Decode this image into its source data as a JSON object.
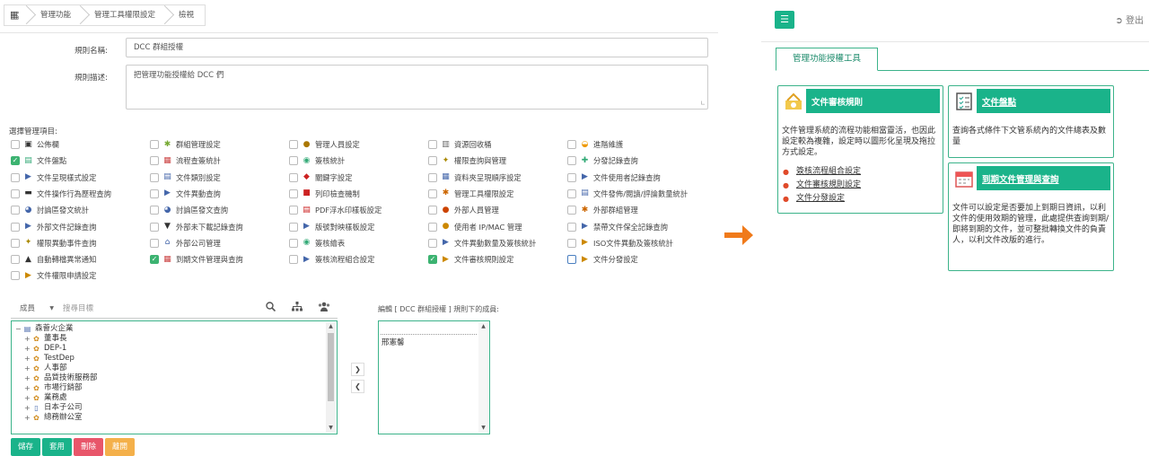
{
  "breadcrumb": [
    "管理功能",
    "管理工具權限設定",
    "檢視"
  ],
  "form": {
    "name_label": "規則名稱:",
    "name_value": "DCC 群組授權",
    "desc_label": "規則描述:",
    "desc_value": "把管理功能授權給 DCC 們"
  },
  "section_title": "選擇管理項目:",
  "permissions": [
    {
      "label": "公佈欄",
      "checked": false,
      "icon": "bulletin-icon"
    },
    {
      "label": "群組管理設定",
      "checked": false,
      "icon": "group-icon"
    },
    {
      "label": "管理人員設定",
      "checked": false,
      "icon": "admin-user-icon"
    },
    {
      "label": "資源回收桶",
      "checked": false,
      "icon": "trash-icon"
    },
    {
      "label": "進階維護",
      "checked": false,
      "icon": "advanced-icon"
    },
    {
      "label": "文件盤點",
      "checked": true,
      "icon": "inventory-icon"
    },
    {
      "label": "流程查簽統計",
      "checked": false,
      "icon": "flow-stat-icon"
    },
    {
      "label": "簽核統計",
      "checked": false,
      "icon": "sign-stat-icon"
    },
    {
      "label": "權限查詢與管理",
      "checked": false,
      "icon": "key-icon"
    },
    {
      "label": "分發記錄查詢",
      "checked": false,
      "icon": "distribute-icon"
    },
    {
      "label": "文件呈現樣式設定",
      "checked": false,
      "icon": "doc-style-icon"
    },
    {
      "label": "文件類別設定",
      "checked": false,
      "icon": "doc-type-icon"
    },
    {
      "label": "關鍵字設定",
      "checked": false,
      "icon": "keyword-icon"
    },
    {
      "label": "資料夾呈現順序設定",
      "checked": false,
      "icon": "folder-order-icon"
    },
    {
      "label": "文件使用者記錄查詢",
      "checked": false,
      "icon": "doc-user-log-icon"
    },
    {
      "label": "文件操作行為歷程查詢",
      "checked": false,
      "icon": "history-icon"
    },
    {
      "label": "文件異動查詢",
      "checked": false,
      "icon": "doc-change-icon"
    },
    {
      "label": "列印檢查機制",
      "checked": false,
      "icon": "print-check-icon"
    },
    {
      "label": "管理工具權限設定",
      "checked": false,
      "icon": "tool-perm-icon"
    },
    {
      "label": "文件發佈/閱讀/評論數量統計",
      "checked": false,
      "icon": "doc-stat-icon"
    },
    {
      "label": "討論區發文統計",
      "checked": false,
      "icon": "forum-stat-icon"
    },
    {
      "label": "討論區發文查詢",
      "checked": false,
      "icon": "forum-query-icon"
    },
    {
      "label": "PDF浮水印樣板設定",
      "checked": false,
      "icon": "pdf-icon"
    },
    {
      "label": "外部人員管理",
      "checked": false,
      "icon": "external-user-icon"
    },
    {
      "label": "外部群組管理",
      "checked": false,
      "icon": "external-group-icon"
    },
    {
      "label": "外部文件記錄查詢",
      "checked": false,
      "icon": "external-doc-icon"
    },
    {
      "label": "外部未下載記錄查詢",
      "checked": false,
      "icon": "download-icon"
    },
    {
      "label": "版號對映樣板設定",
      "checked": false,
      "icon": "version-icon"
    },
    {
      "label": "使用者 IP/MAC 管理",
      "checked": false,
      "icon": "ip-icon"
    },
    {
      "label": "禁帶文件保全記錄查詢",
      "checked": false,
      "icon": "secure-icon"
    },
    {
      "label": "權限異動事件查詢",
      "checked": false,
      "icon": "perm-event-icon"
    },
    {
      "label": "外部公司管理",
      "checked": false,
      "icon": "company-icon"
    },
    {
      "label": "簽核繪表",
      "checked": false,
      "icon": "sign-chart-icon"
    },
    {
      "label": "文件異動數量及簽核統計",
      "checked": false,
      "icon": "doc-change-stat-icon"
    },
    {
      "label": "ISO文件異動及簽核統計",
      "checked": false,
      "icon": "iso-icon"
    },
    {
      "label": "自動轉檔異常通知",
      "checked": false,
      "icon": "warning-icon"
    },
    {
      "label": "到期文件管理與查詢",
      "checked": true,
      "icon": "calendar-icon"
    },
    {
      "label": "簽核流程組合設定",
      "checked": false,
      "icon": "sign-flow-icon"
    },
    {
      "label": "文件審核規則設定",
      "checked": true,
      "icon": "review-rule-icon"
    },
    {
      "label": "文件分發設定",
      "checked": false,
      "icon": "doc-distribute-icon"
    },
    {
      "label": "文件權限申請設定",
      "checked": false,
      "icon": "perm-apply-icon"
    }
  ],
  "picker": {
    "select_value": "成員",
    "search_placeholder": "搜尋目標"
  },
  "tree": [
    {
      "label": "森薈火企業",
      "toggle": "−",
      "icon": "org-root-icon",
      "level": 0
    },
    {
      "label": "董事長",
      "toggle": "+",
      "icon": "dept-icon",
      "level": 1
    },
    {
      "label": "DEP-1",
      "toggle": "+",
      "icon": "dept-icon",
      "level": 1
    },
    {
      "label": "TestDep",
      "toggle": "+",
      "icon": "dept-icon",
      "level": 1
    },
    {
      "label": "人事部",
      "toggle": "+",
      "icon": "dept-icon",
      "level": 1
    },
    {
      "label": "品質技術服務部",
      "toggle": "+",
      "icon": "dept-icon",
      "level": 1
    },
    {
      "label": "市場行銷部",
      "toggle": "+",
      "icon": "dept-icon",
      "level": 1
    },
    {
      "label": "業務處",
      "toggle": "+",
      "icon": "dept-icon",
      "level": 1
    },
    {
      "label": "日本子公司",
      "toggle": "+",
      "icon": "company-icon",
      "level": 1
    },
    {
      "label": "總務辦公室",
      "toggle": "+",
      "icon": "dept-icon",
      "level": 1
    }
  ],
  "members": {
    "label": "編輯 [ DCC 群組授權 ] 規則下的成員:",
    "items": [
      "邢憲馨"
    ]
  },
  "actions": [
    {
      "label": "儲存",
      "color": "#1ab38a"
    },
    {
      "label": "套用",
      "color": "#1ab38a"
    },
    {
      "label": "刪除",
      "color": "#e8566a"
    },
    {
      "label": "離開",
      "color": "#f4b04a"
    }
  ],
  "right": {
    "logout_label": "登出",
    "tab_label": "管理功能授權工具",
    "cards": [
      {
        "title": "文件審核規則",
        "icon": "review-rule-icon",
        "desc": "文件管理系統的流程功能相當靈活，也因此設定較為複雜，設定時以圖形化呈現及拖拉方式設定。",
        "links": [
          "簽核流程組合設定",
          "文件審核規則設定",
          "文件分發設定"
        ]
      },
      {
        "title": "文件盤點",
        "icon": "inventory-icon",
        "desc": "查詢各式條件下文管系統內的文件總表及數量",
        "links": []
      },
      {
        "title": "到期文件管理與查詢",
        "icon": "calendar-icon",
        "desc": "文件可以設定是否要加上到期日資訊，以利文件的使用效期的管理，此處提供查詢到期/即將到期的文件，並可整批轉換文件的負責人，以利文件改版的進行。",
        "links": []
      }
    ]
  },
  "colors": {
    "accent": "#1ab38a",
    "delete": "#e8566a",
    "leave": "#f4b04a",
    "arrow": "#f07a1a"
  }
}
